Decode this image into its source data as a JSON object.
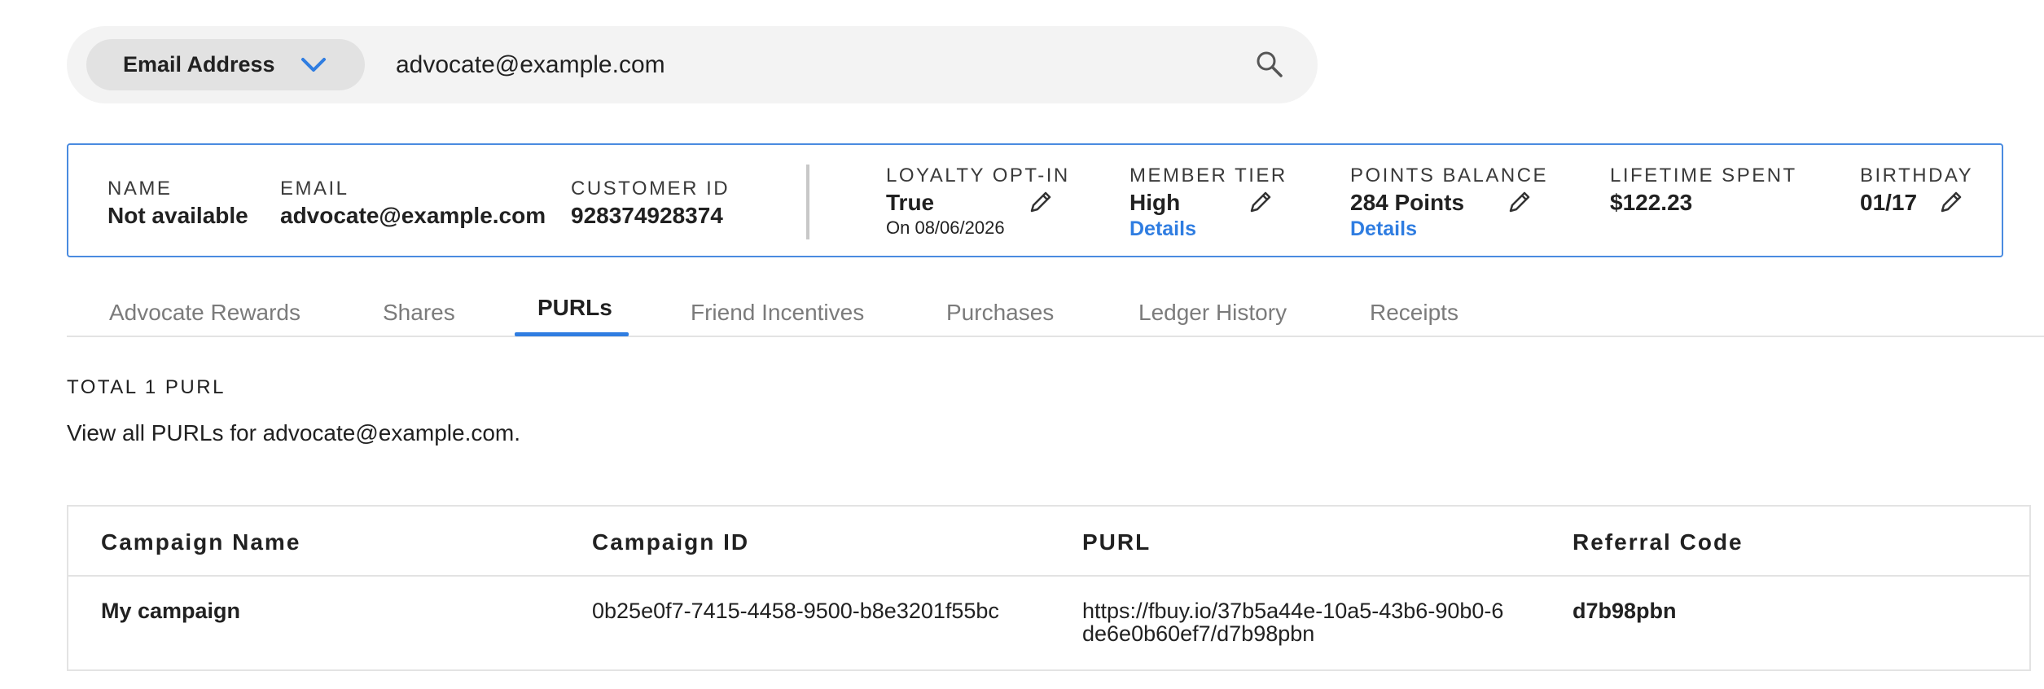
{
  "search": {
    "type_label": "Email Address",
    "value": "advocate@example.com"
  },
  "customer": {
    "name_label": "NAME",
    "name_value": "Not available",
    "email_label": "EMAIL",
    "email_value": "advocate@example.com",
    "id_label": "CUSTOMER ID",
    "id_value": "928374928374",
    "loyalty_label": "LOYALTY OPT-IN",
    "loyalty_value": "True",
    "loyalty_sub": "On 08/06/2026",
    "tier_label": "MEMBER TIER",
    "tier_value": "High",
    "tier_link": "Details",
    "points_label": "POINTS BALANCE",
    "points_value": "284 Points",
    "points_link": "Details",
    "lifetime_label": "LIFETIME SPENT",
    "lifetime_value": "$122.23",
    "birthday_label": "BIRTHDAY",
    "birthday_value": "01/17"
  },
  "tabs": [
    {
      "label": "Advocate Rewards"
    },
    {
      "label": "Shares"
    },
    {
      "label": "PURLs"
    },
    {
      "label": "Friend Incentives"
    },
    {
      "label": "Purchases"
    },
    {
      "label": "Ledger History"
    },
    {
      "label": "Receipts"
    }
  ],
  "active_tab": "PURLs",
  "summary": {
    "total": "TOTAL 1 PURL",
    "description": "View all PURLs for advocate@example.com."
  },
  "table": {
    "headers": [
      "Campaign Name",
      "Campaign ID",
      "PURL",
      "Referral Code"
    ],
    "rows": [
      {
        "campaign_name": "My campaign",
        "campaign_id": "0b25e0f7-7415-4458-9500-b8e3201f55bc",
        "purl": "https://fbuy.io/37b5a44e-10a5-43b6-90b0-6de6e0b60ef7/d7b98pbn",
        "referral_code": "d7b98pbn"
      }
    ]
  },
  "colors": {
    "accent": "#2f7de1",
    "card_border": "#4a8be0",
    "search_bg": "#f3f3f3"
  }
}
